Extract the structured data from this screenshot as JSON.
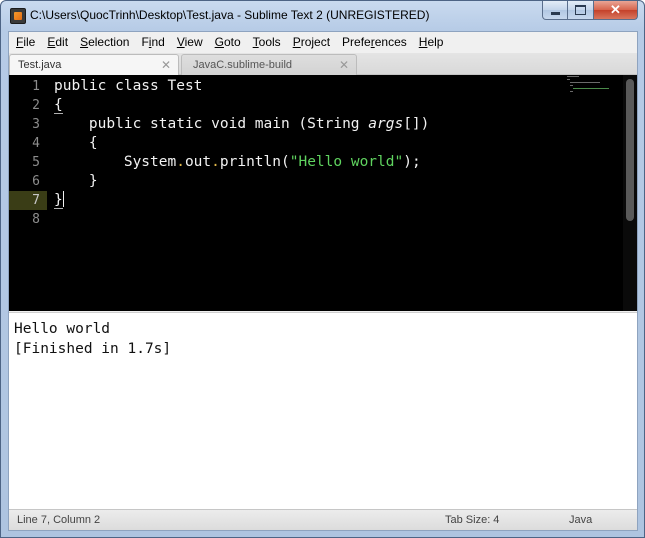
{
  "window": {
    "title": "C:\\Users\\QuocTrinh\\Desktop\\Test.java - Sublime Text 2 (UNREGISTERED)",
    "controls": {
      "minimize": "minimize",
      "maximize": "maximize",
      "close": "✕"
    }
  },
  "menu": [
    {
      "key": "F",
      "rest": "ile"
    },
    {
      "key": "E",
      "rest": "dit"
    },
    {
      "key": "S",
      "rest": "election"
    },
    {
      "key": "F",
      "rest": "i",
      "pre": "",
      "alt": "Find"
    },
    {
      "key": "V",
      "rest": "iew"
    },
    {
      "key": "G",
      "rest": "oto"
    },
    {
      "key": "T",
      "rest": "ools"
    },
    {
      "key": "P",
      "rest": "roject"
    },
    {
      "key": "",
      "rest": "Preferences",
      "pre": "Prefe",
      "mid": "r",
      "post": "ences"
    },
    {
      "key": "H",
      "rest": "elp"
    }
  ],
  "menu_labels": {
    "file": {
      "u": "F",
      "t": "ile"
    },
    "edit": {
      "u": "E",
      "t": "dit"
    },
    "selection": {
      "u": "S",
      "t": "election"
    },
    "find": {
      "p": "F",
      "u": "i",
      "t": "nd"
    },
    "view": {
      "u": "V",
      "t": "iew"
    },
    "goto": {
      "u": "G",
      "t": "oto"
    },
    "tools": {
      "u": "T",
      "t": "ools"
    },
    "project": {
      "u": "P",
      "t": "roject"
    },
    "preferences": {
      "p": "Prefe",
      "u": "r",
      "t": "ences"
    },
    "help": {
      "u": "H",
      "t": "elp"
    }
  },
  "tabs": [
    {
      "label": "Test.java",
      "close": "✕",
      "active": true
    },
    {
      "label": "JavaC.sublime-build",
      "close": "✕",
      "active": false
    }
  ],
  "editor": {
    "line_numbers": [
      "1",
      "2",
      "3",
      "4",
      "5",
      "6",
      "7",
      "8"
    ],
    "current_line": "7",
    "lines": {
      "l1": "public class Test",
      "l2": "{",
      "l3a": "    public static void main (String ",
      "l3b": "args",
      "l3c": "[])",
      "l4": "    {",
      "l5a": "        System",
      "l5b": ".",
      "l5c": "out",
      "l5d": ".",
      "l5e": "println(",
      "l5f": "\"Hello world\"",
      "l5g": ");",
      "l6": "    }",
      "l7": "}",
      "l8": ""
    }
  },
  "output": {
    "line1": "Hello world",
    "line2": "[Finished in 1.7s]"
  },
  "status": {
    "position": "Line 7, Column 2",
    "tab_size": "Tab Size: 4",
    "syntax": "Java"
  },
  "colors": {
    "editor_bg": "#000000",
    "string": "#5fd35f",
    "current_line_gutter": "#3a3d16",
    "titlebar": "#b6cbe6"
  }
}
